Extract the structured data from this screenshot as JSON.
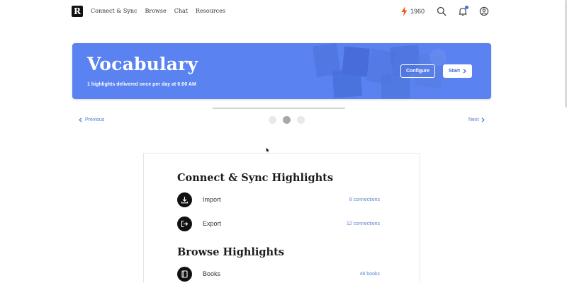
{
  "nav": {
    "logo_letter": "R",
    "links": [
      "Connect & Sync",
      "Browse",
      "Chat",
      "Resources"
    ],
    "streak_count": "1960",
    "accent": "#3b6fe0"
  },
  "hero": {
    "title": "Vocabulary",
    "subtitle": "1 highlights delivered once per day at 6:00 AM",
    "configure_label": "Configure",
    "start_label": "Start",
    "background": "#5a82f0"
  },
  "carousel": {
    "previous_label": "Previous",
    "next_label": "Next",
    "dots": 3,
    "active_dot": 1
  },
  "card": {
    "sections": [
      {
        "title": "Connect & Sync Highlights",
        "rows": [
          {
            "label": "Import",
            "meta": "8 connections",
            "icon": "download-icon"
          },
          {
            "label": "Export",
            "meta": "12 connections",
            "icon": "export-icon"
          }
        ]
      },
      {
        "title": "Browse Highlights",
        "rows": [
          {
            "label": "Books",
            "meta": "46 books",
            "icon": "book-icon"
          }
        ]
      }
    ]
  }
}
